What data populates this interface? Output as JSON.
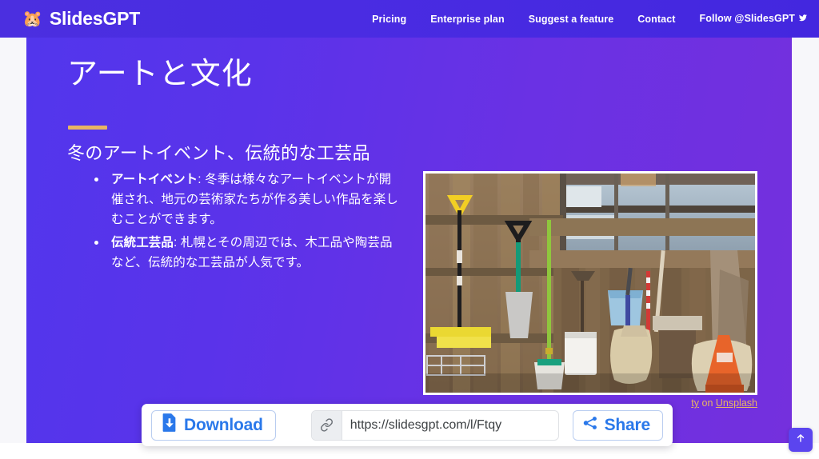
{
  "nav": {
    "brand": {
      "logo_icon": "hamster-logo-icon",
      "logo_glyph": "🐹",
      "name": "SlidesGPT"
    },
    "links": [
      {
        "label": "Pricing",
        "name": "nav-link-pricing"
      },
      {
        "label": "Enterprise plan",
        "name": "nav-link-enterprise-plan"
      },
      {
        "label": "Suggest a feature",
        "name": "nav-link-suggest-a-feature"
      },
      {
        "label": "Contact",
        "name": "nav-link-contact"
      },
      {
        "label": "Follow @SlidesGPT",
        "name": "nav-link-follow-slidesgpt"
      }
    ]
  },
  "slide": {
    "title": "アートと文化",
    "subtitle": "冬のアートイベント、伝統的な工芸品",
    "bullets": [
      {
        "term": "アートイベント",
        "body": ": 冬季は様々なアートイベントが開催され、地元の芸術家たちが作る美しい作品を楽しむことができます。"
      },
      {
        "term": "伝統工芸品",
        "body": ": 札幌とその周辺では、木工品や陶芸品など、伝統的な工芸品が人気です。"
      }
    ],
    "photo_alt": "Garden and cleaning tools leaning against a weathered wooden wall",
    "credit": {
      "photographer_partial": "ty",
      "middle": " on ",
      "source": "Unsplash"
    },
    "accent_color": "#e8b563",
    "background_from": "#5236ec",
    "background_to": "#7430dd"
  },
  "sharebar": {
    "download_label": "Download",
    "download_icon": "file-download-icon",
    "link_icon": "link-icon",
    "url_value": "https://slidesgpt.com/l/Ftqy",
    "url_placeholder": "https://slidesgpt.com/l/",
    "share_label": "Share",
    "share_icon": "share-nodes-icon",
    "accent_color": "#2a78ea"
  },
  "scroll_top": {
    "icon": "arrow-up-icon",
    "color": "#5b45ef"
  }
}
